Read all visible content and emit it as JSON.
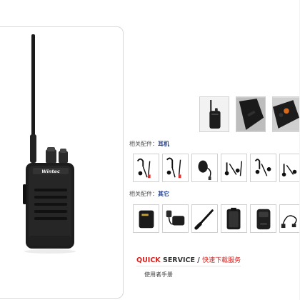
{
  "product": {
    "brand_text": "Wintec",
    "image_name": "two-way-radio"
  },
  "thumbnails": [
    {
      "name": "radio-front-thumb"
    },
    {
      "name": "radio-side-thumb"
    },
    {
      "name": "radio-top-thumb"
    }
  ],
  "sections": {
    "earphone": {
      "prefix": "相关配件：",
      "highlight": "耳机"
    },
    "other": {
      "prefix": "相关配件：",
      "highlight": "其它"
    }
  },
  "earphones": [
    {
      "name": "earpiece-1"
    },
    {
      "name": "earpiece-2"
    },
    {
      "name": "speaker-mic"
    },
    {
      "name": "earpiece-3"
    },
    {
      "name": "earpiece-4"
    },
    {
      "name": "earpiece-5"
    }
  ],
  "others": [
    {
      "name": "battery"
    },
    {
      "name": "charger"
    },
    {
      "name": "antenna"
    },
    {
      "name": "belt-clip"
    },
    {
      "name": "carry-case"
    },
    {
      "name": "usb-cable"
    }
  ],
  "quick_service": {
    "quick": "QUICK",
    "service": " SERVICE",
    "slash": " / ",
    "cn": "快速下载服务"
  },
  "manual_label": "使用者手册",
  "colors": {
    "accent_red": "#d9201c",
    "accent_blue": "#1d3f8f"
  }
}
